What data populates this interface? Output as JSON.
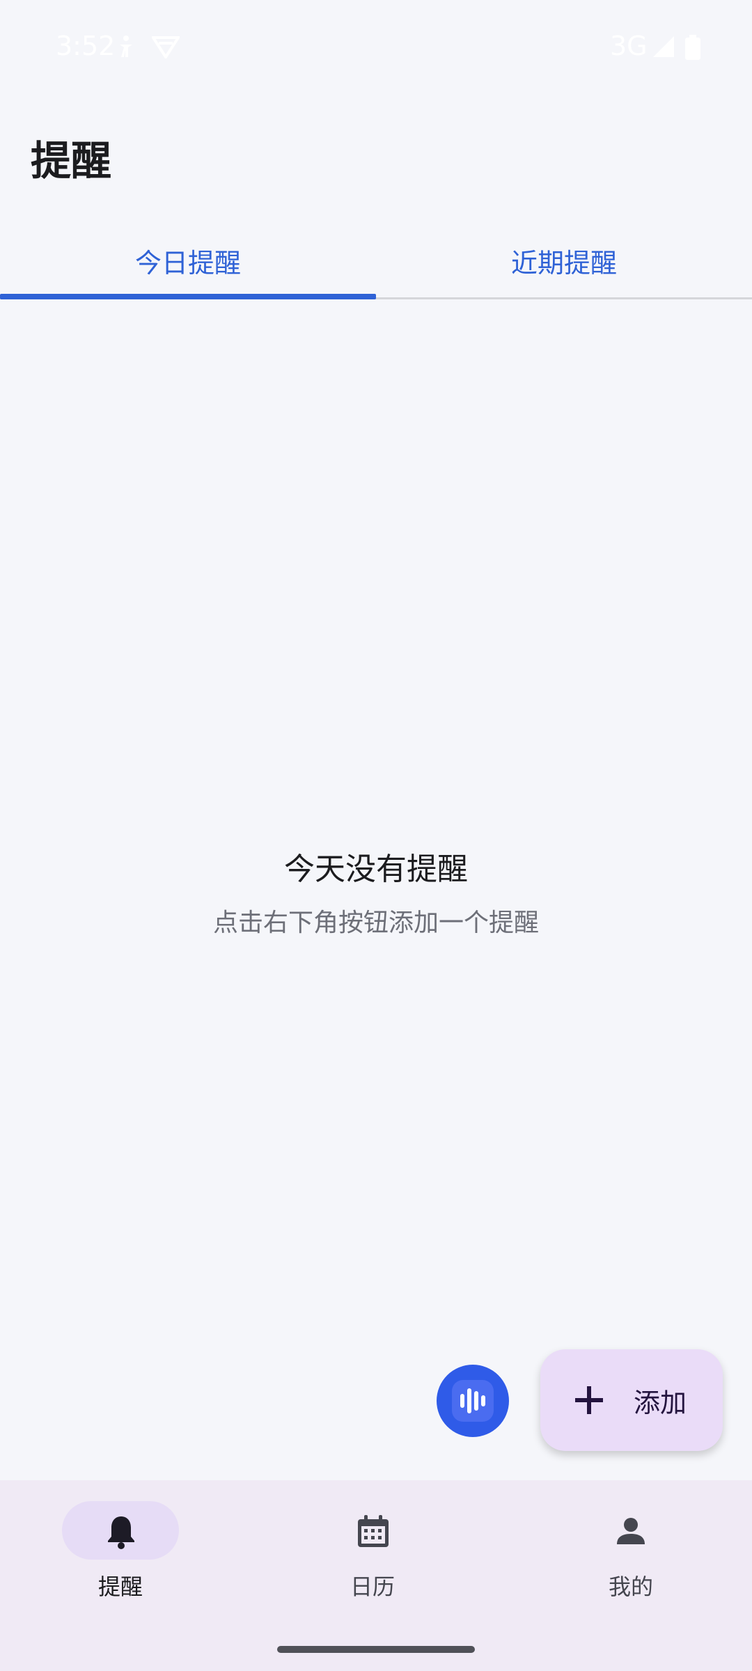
{
  "status_bar": {
    "time": "3:52",
    "network": "3G"
  },
  "header": {
    "title": "提醒"
  },
  "tabs": [
    {
      "label": "今日提醒",
      "selected": true
    },
    {
      "label": "近期提醒",
      "selected": false
    }
  ],
  "empty_state": {
    "title": "今天没有提醒",
    "subtitle": "点击右下角按钮添加一个提醒"
  },
  "fab": {
    "add_label": "添加",
    "voice_icon": "voice-wave-icon"
  },
  "bottom_nav": {
    "items": [
      {
        "label": "提醒",
        "icon": "bell-icon",
        "active": true
      },
      {
        "label": "日历",
        "icon": "calendar-icon",
        "active": false
      },
      {
        "label": "我的",
        "icon": "person-icon",
        "active": false
      }
    ]
  },
  "colors": {
    "accent": "#2f62d6",
    "background": "#f5f6fa",
    "fab_bg": "#eadcf8",
    "nav_bg": "#f0eaf5",
    "voice_button": "#2f5be8"
  }
}
